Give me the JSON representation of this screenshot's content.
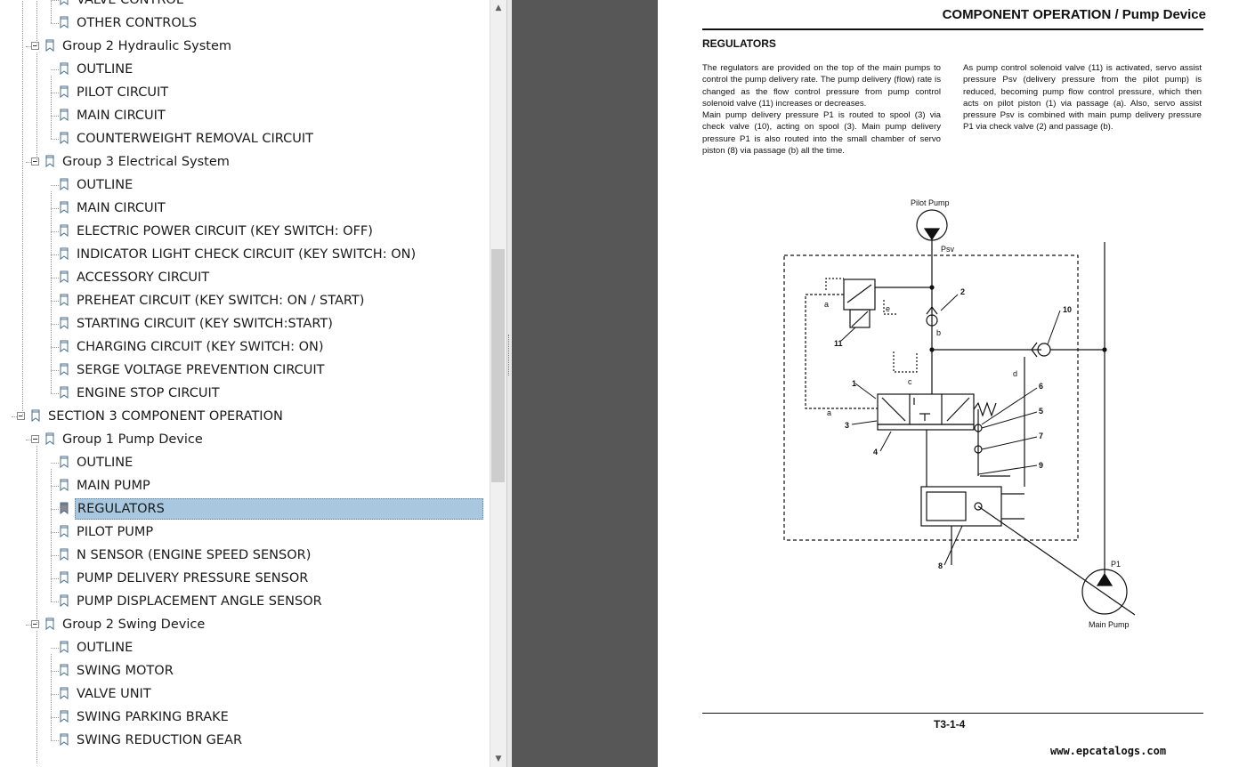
{
  "bookmarks": {
    "items": [
      {
        "label": "VALVE CONTROL",
        "level": 3
      },
      {
        "label": "OTHER CONTROLS",
        "level": 3
      },
      {
        "label": "Group 2 Hydraulic System",
        "level": 2
      },
      {
        "label": "OUTLINE",
        "level": 3
      },
      {
        "label": "PILOT CIRCUIT",
        "level": 3
      },
      {
        "label": "MAIN CIRCUIT",
        "level": 3
      },
      {
        "label": "COUNTERWEIGHT REMOVAL CIRCUIT",
        "level": 3
      },
      {
        "label": "Group 3 Electrical System",
        "level": 2
      },
      {
        "label": "OUTLINE",
        "level": 3
      },
      {
        "label": "MAIN CIRCUIT",
        "level": 3
      },
      {
        "label": "ELECTRIC POWER CIRCUIT (KEY SWITCH: OFF)",
        "level": 3
      },
      {
        "label": "INDICATOR LIGHT CHECK CIRCUIT (KEY  SWITCH: ON)",
        "level": 3
      },
      {
        "label": "ACCESSORY CIRCUIT",
        "level": 3
      },
      {
        "label": "PREHEAT CIRCUIT (KEY SWITCH: ON /  START)",
        "level": 3
      },
      {
        "label": "STARTING CIRCUIT (KEY SWITCH:START)",
        "level": 3
      },
      {
        "label": "CHARGING CIRCUIT (KEY SWITCH: ON)",
        "level": 3
      },
      {
        "label": "SERGE VOLTAGE PREVENTION CIRCUIT",
        "level": 3
      },
      {
        "label": "ENGINE STOP CIRCUIT",
        "level": 3
      },
      {
        "label": "SECTION 3  COMPONENT OPERATION",
        "level": 1
      },
      {
        "label": "Group 1 Pump Device",
        "level": 2
      },
      {
        "label": "OUTLINE",
        "level": 3
      },
      {
        "label": "MAIN PUMP",
        "level": 3
      },
      {
        "label": "REGULATORS",
        "level": 3,
        "selected": true
      },
      {
        "label": "PILOT PUMP",
        "level": 3
      },
      {
        "label": "N SENSOR (ENGINE SPEED SENSOR)",
        "level": 3
      },
      {
        "label": "PUMP DELIVERY PRESSURE SENSOR",
        "level": 3
      },
      {
        "label": "PUMP DISPLACEMENT ANGLE SENSOR",
        "level": 3
      },
      {
        "label": "Group 2 Swing Device",
        "level": 2
      },
      {
        "label": "OUTLINE",
        "level": 3
      },
      {
        "label": "SWING MOTOR",
        "level": 3
      },
      {
        "label": "VALVE UNIT",
        "level": 3
      },
      {
        "label": "SWING PARKING BRAKE",
        "level": 3
      },
      {
        "label": "SWING REDUCTION GEAR",
        "level": 3
      }
    ]
  },
  "scrollbar": {
    "up_icon": "▲",
    "down_icon": "▼"
  },
  "document": {
    "title": "COMPONENT OPERATION / Pump Device",
    "section_heading": "REGULATORS",
    "para_left": "The regulators are provided on the top of the main pumps to control the pump delivery rate. The pump delivery (flow) rate is changed as the flow control pressure from pump control solenoid valve (11) increases or decreases.\nMain pump delivery pressure P1 is routed to spool (3) via check valve (10), acting on spool (3). Main pump delivery pressure P1 is also routed into the small chamber of servo piston (8) via passage (b) all the time.",
    "para_right": "As pump control solenoid valve (11) is activated, servo assist pressure Psv (delivery pressure from the pilot pump) is reduced, becoming pump flow control pressure, which then acts on pilot piston (1) via passage (a). Also, servo assist pressure Psv is combined with main pump delivery pressure P1 via check valve (2) and passage (b).",
    "page_number": "T3-1-4",
    "watermark": "www.epcatalogs.com"
  },
  "diagram": {
    "pilot_pump_label": "Pilot Pump",
    "main_pump_label": "Main Pump",
    "psv_label": "Psv",
    "p1_label": "P1",
    "numbers": [
      "1",
      "2",
      "3",
      "4",
      "5",
      "6",
      "7",
      "8",
      "9",
      "10",
      "11"
    ],
    "letters": [
      "a",
      "a",
      "b",
      "c",
      "d",
      "e"
    ]
  }
}
